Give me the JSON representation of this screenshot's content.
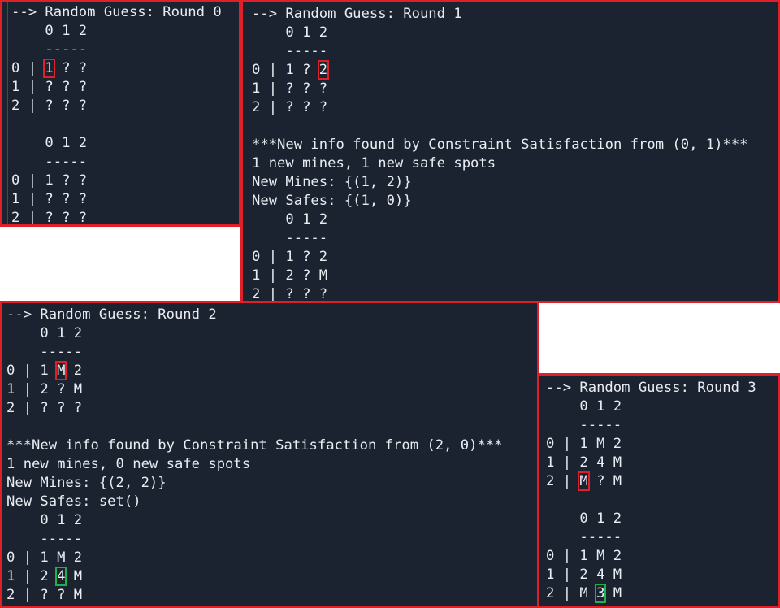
{
  "panels": [
    {
      "lines": [
        "--> Random Guess: Round 0",
        "    0 1 2",
        "    -----",
        [
          "0 | ",
          {
            "t": "1",
            "hl": "red"
          },
          " ? ?"
        ],
        "1 | ? ? ?",
        "2 | ? ? ?",
        "",
        "    0 1 2",
        "    -----",
        "0 | 1 ? ?",
        "1 | ? ? ?",
        "2 | ? ? ?"
      ]
    },
    {
      "lines": [
        "--> Random Guess: Round 1",
        "    0 1 2",
        "    -----",
        [
          "0 | 1 ? ",
          {
            "t": "2",
            "hl": "red"
          }
        ],
        "1 | ? ? ?",
        "2 | ? ? ?",
        "",
        "***New info found by Constraint Satisfaction from (0, 1)***",
        "1 new mines, 1 new safe spots",
        "New Mines: {(1, 2)}",
        "New Safes: {(1, 0)}",
        "    0 1 2",
        "    -----",
        "0 | 1 ? 2",
        "1 | 2 ? M",
        "2 | ? ? ?"
      ]
    },
    {
      "lines": [
        "--> Random Guess: Round 2",
        "    0 1 2",
        "    -----",
        [
          "0 | 1 ",
          {
            "t": "M",
            "hl": "red"
          },
          " 2"
        ],
        "1 | 2 ? M",
        "2 | ? ? ?",
        "",
        "***New info found by Constraint Satisfaction from (2, 0)***",
        "1 new mines, 0 new safe spots",
        "New Mines: {(2, 2)}",
        "New Safes: set()",
        "    0 1 2",
        "    -----",
        "0 | 1 M 2",
        [
          "1 | 2 ",
          {
            "t": "4",
            "hl": "green"
          },
          " M"
        ],
        "2 | ? ? M"
      ]
    },
    {
      "lines": [
        "--> Random Guess: Round 3",
        "    0 1 2",
        "    -----",
        "0 | 1 M 2",
        "1 | 2 4 M",
        [
          "2 | ",
          {
            "t": "M",
            "hl": "red"
          },
          " ? M"
        ],
        "",
        "    0 1 2",
        "    -----",
        "0 | 1 M 2",
        "1 | 2 4 M",
        [
          "2 | M ",
          {
            "t": "3",
            "hl": "green"
          },
          " M"
        ]
      ]
    }
  ]
}
